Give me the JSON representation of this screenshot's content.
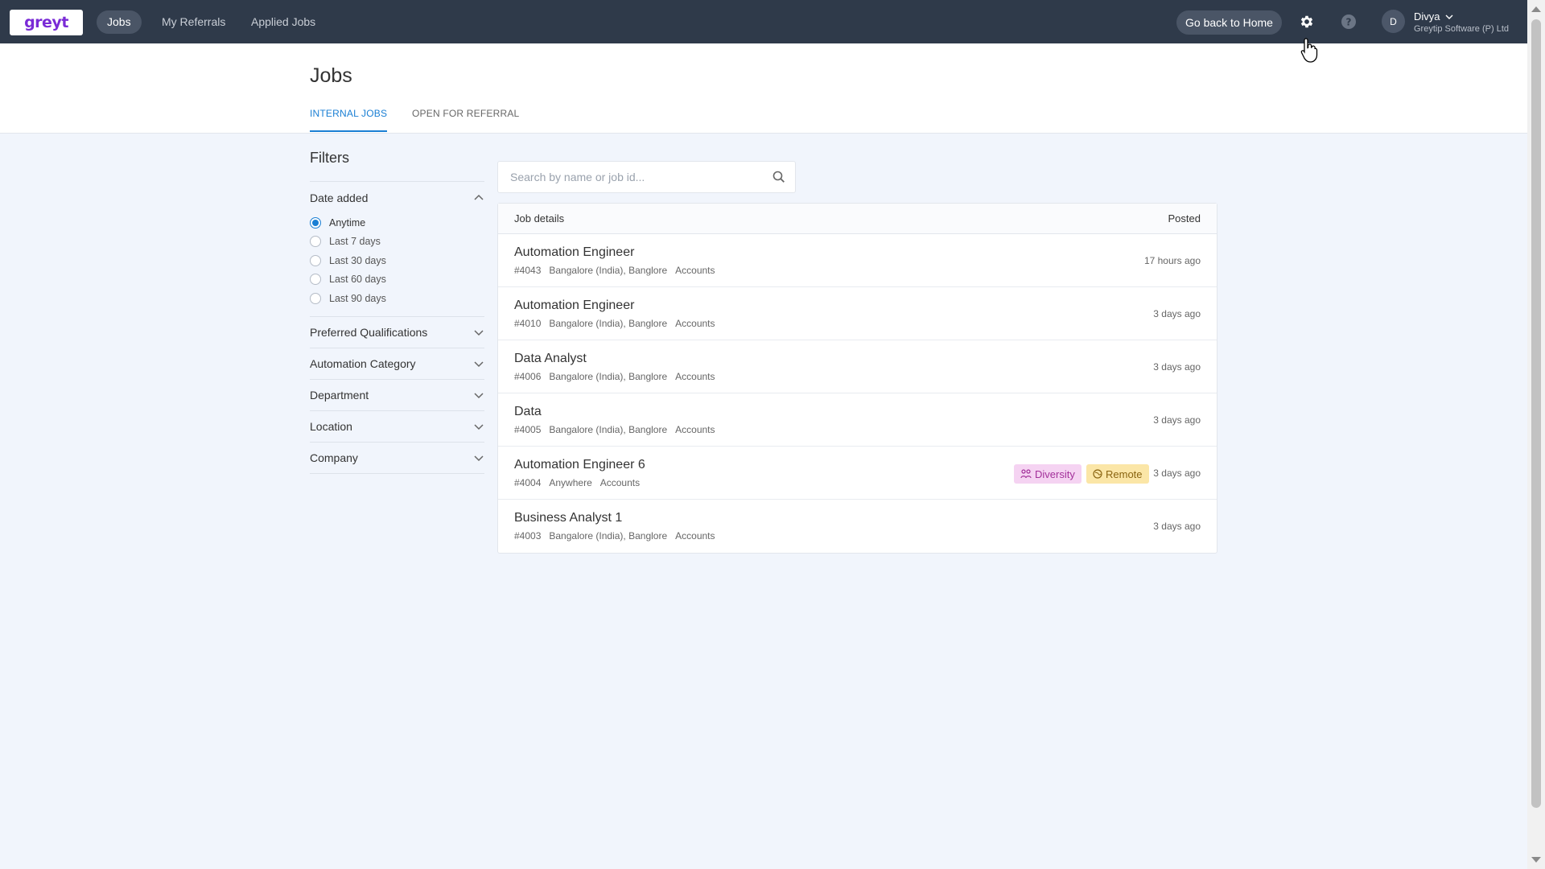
{
  "nav": {
    "logo": "greyt",
    "items": [
      {
        "label": "Jobs",
        "active": true
      },
      {
        "label": "My Referrals",
        "active": false
      },
      {
        "label": "Applied Jobs",
        "active": false
      }
    ],
    "home_button": "Go back to Home",
    "settings_icon": "gear-icon",
    "help_icon": "help-icon",
    "user": {
      "initial": "D",
      "name": "Divya",
      "company": "Greytip Software (P) Ltd"
    }
  },
  "page": {
    "title": "Jobs",
    "tabs": [
      {
        "label": "INTERNAL JOBS",
        "active": true
      },
      {
        "label": "OPEN FOR REFERRAL",
        "active": false
      }
    ]
  },
  "filters": {
    "title": "Filters",
    "date_added": {
      "label": "Date added",
      "options": [
        "Anytime",
        "Last 7 days",
        "Last 30 days",
        "Last 60 days",
        "Last 90 days"
      ],
      "selected": "Anytime"
    },
    "sections": [
      "Preferred Qualifications",
      "Automation Category",
      "Department",
      "Location",
      "Company"
    ]
  },
  "search": {
    "placeholder": "Search by name or job id..."
  },
  "jobs": {
    "header": {
      "details": "Job details",
      "posted": "Posted"
    },
    "rows": [
      {
        "title": "Automation Engineer",
        "id": "#4043",
        "location": "Bangalore (India), Banglore",
        "dept": "Accounts",
        "posted": "17 hours ago"
      },
      {
        "title": "Automation Engineer",
        "id": "#4010",
        "location": "Bangalore (India), Banglore",
        "dept": "Accounts",
        "posted": "3 days ago"
      },
      {
        "title": "Data Analyst",
        "id": "#4006",
        "location": "Bangalore (India), Banglore",
        "dept": "Accounts",
        "posted": "3 days ago"
      },
      {
        "title": "Data",
        "id": "#4005",
        "location": "Bangalore (India), Banglore",
        "dept": "Accounts",
        "posted": "3 days ago"
      },
      {
        "title": "Automation Engineer 6",
        "id": "#4004",
        "location": "Anywhere",
        "dept": "Accounts",
        "posted": "3 days ago",
        "tags": [
          "Diversity",
          "Remote"
        ]
      },
      {
        "title": "Business Analyst 1",
        "id": "#4003",
        "location": "Bangalore (India), Banglore",
        "dept": "Accounts",
        "posted": "3 days ago"
      }
    ]
  },
  "colors": {
    "nav_bg": "#2f3a4a",
    "accent": "#1a7fd4",
    "logo": "#7a2bd6"
  }
}
